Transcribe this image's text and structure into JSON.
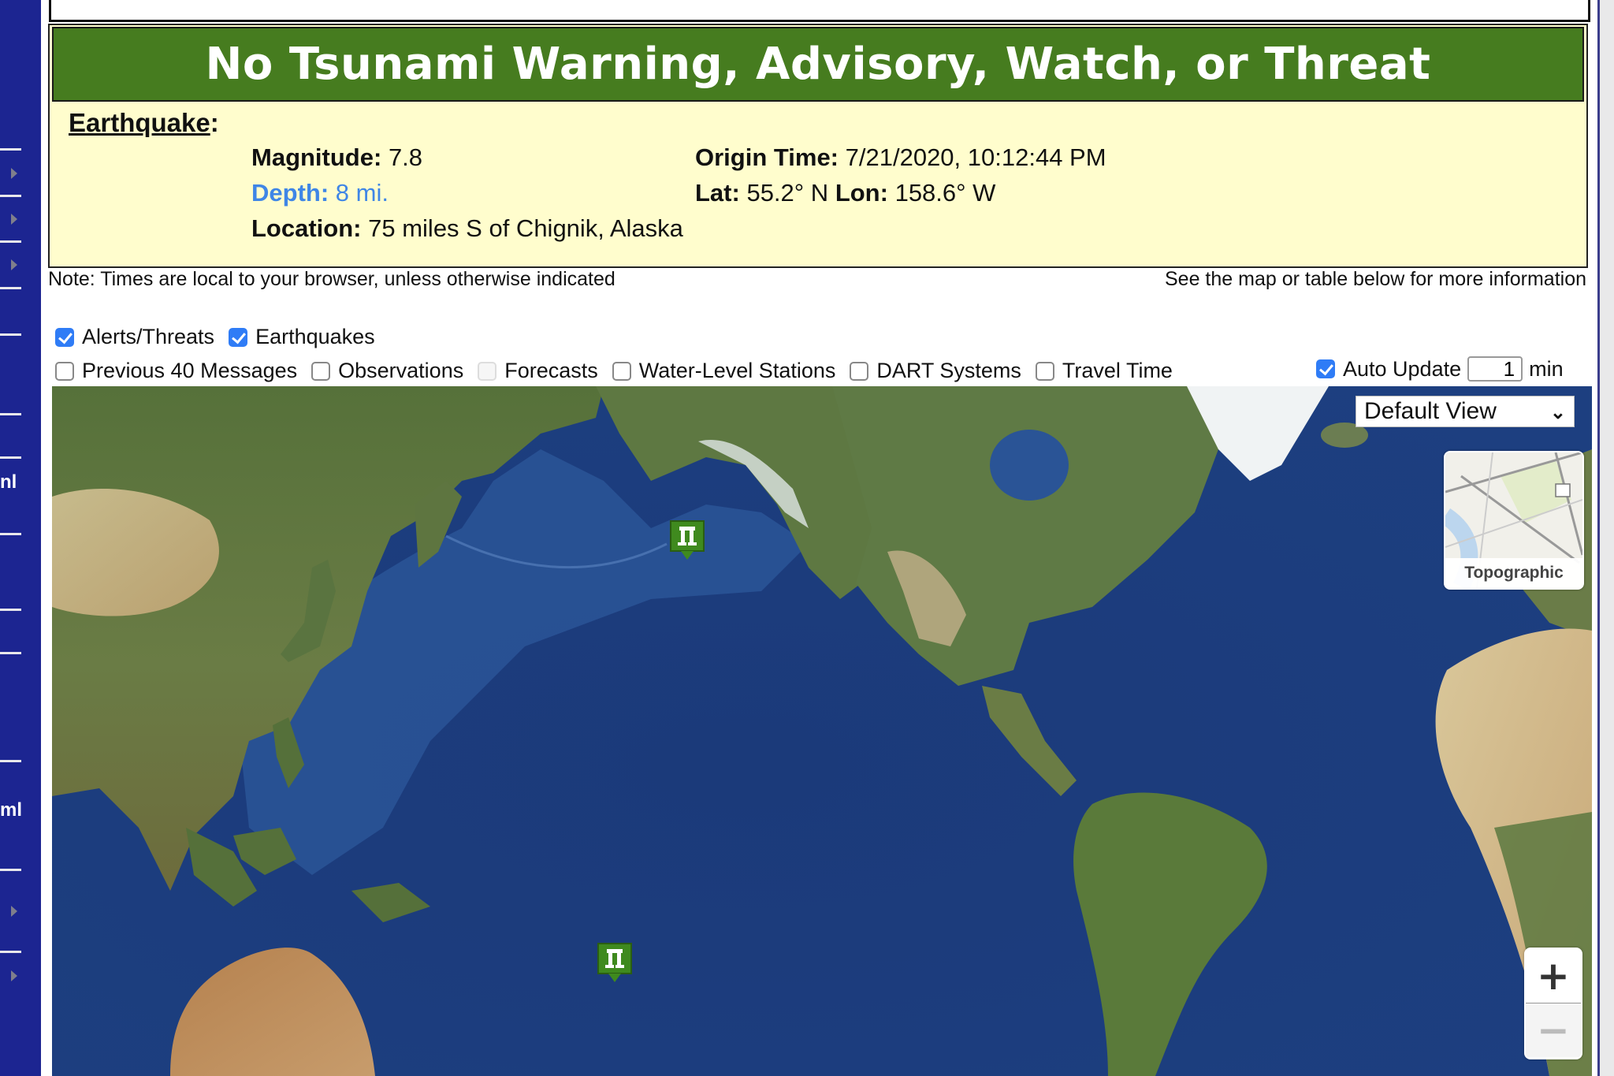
{
  "sidebar": {
    "partial_labels": [
      "nl",
      "ml"
    ]
  },
  "banner": {
    "status": "No Tsunami Warning, Advisory, Watch, or Threat",
    "color": "#467c1f"
  },
  "earthquake": {
    "heading": "Earthquake",
    "magnitude_label": "Magnitude:",
    "magnitude": "7.8",
    "depth_label": "Depth:",
    "depth": "8 mi.",
    "location_label": "Location:",
    "location": "75 miles S of Chignik, Alaska",
    "origin_time_label": "Origin Time:",
    "origin_time": "7/21/2020, 10:12:44 PM",
    "lat_label": "Lat:",
    "lat": "55.2° N",
    "lon_label": "Lon:",
    "lon": "158.6° W"
  },
  "notes": {
    "left": "Note: Times are local to your browser, unless otherwise indicated",
    "right": "See the map or table below for more information"
  },
  "layers": {
    "row1": [
      {
        "label": "Alerts/Threats",
        "checked": true,
        "disabled": false
      },
      {
        "label": "Earthquakes",
        "checked": true,
        "disabled": false
      }
    ],
    "row2": [
      {
        "label": "Previous 40 Messages",
        "checked": false,
        "disabled": false
      },
      {
        "label": "Observations",
        "checked": false,
        "disabled": false
      },
      {
        "label": "Forecasts",
        "checked": false,
        "disabled": true
      },
      {
        "label": "Water-Level Stations",
        "checked": false,
        "disabled": false
      },
      {
        "label": "DART Systems",
        "checked": false,
        "disabled": false
      },
      {
        "label": "Travel Time",
        "checked": false,
        "disabled": false
      }
    ]
  },
  "auto_update": {
    "label": "Auto Update",
    "checked": true,
    "value": "1",
    "unit": "min"
  },
  "map": {
    "view_select": "Default View",
    "basemap_label": "Topographic",
    "zoom_in": "+",
    "zoom_out": "−",
    "markers": [
      {
        "name": "tsunami-event-marker-alaska",
        "icon": "tsunami-gauge-icon"
      },
      {
        "name": "tsunami-event-marker-south-pacific",
        "icon": "tsunami-gauge-icon"
      }
    ]
  }
}
